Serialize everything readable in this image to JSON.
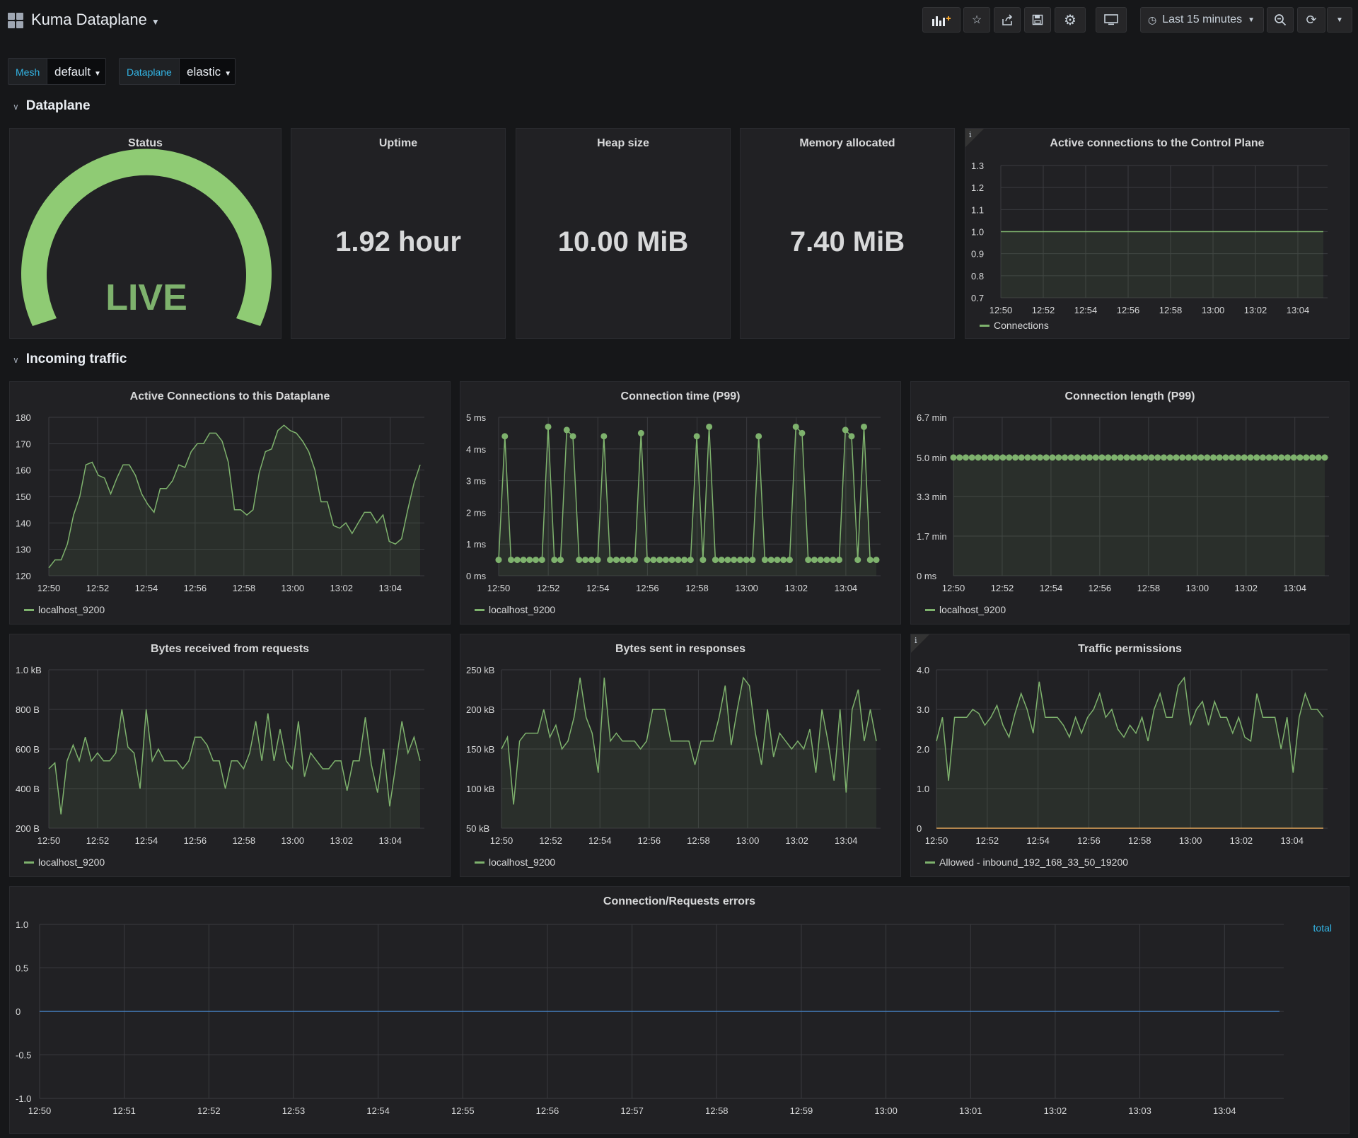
{
  "header": {
    "title": "Kuma Dataplane",
    "time_range": "Last 15 minutes"
  },
  "variables": [
    {
      "label": "Mesh",
      "value": "default"
    },
    {
      "label": "Dataplane",
      "value": "elastic"
    }
  ],
  "rows": {
    "dataplane": "Dataplane",
    "incoming": "Incoming traffic"
  },
  "panels": {
    "status": {
      "title": "Status",
      "value": "LIVE"
    },
    "uptime": {
      "title": "Uptime",
      "value": "1.92 hour"
    },
    "heap": {
      "title": "Heap size",
      "value": "10.00 MiB"
    },
    "memory": {
      "title": "Memory allocated",
      "value": "7.40 MiB"
    }
  },
  "colors": {
    "green": "#7eb26d",
    "gauge": "#8fcb74",
    "blue": "#33b5e5",
    "orange": "#e5a85d",
    "errors": "#447ebc"
  },
  "icons": [
    "add-panel-icon",
    "star-icon",
    "share-icon",
    "save-icon",
    "gear-icon",
    "tv-icon",
    "clock-icon",
    "zoom-out-icon",
    "refresh-icon",
    "chevron-down-icon"
  ],
  "chart_data": [
    {
      "id": "ctrl",
      "type": "line",
      "title": "Active connections to the Control Plane",
      "x": [
        "12:50",
        "12:52",
        "12:54",
        "12:56",
        "12:58",
        "13:00",
        "13:02",
        "13:04"
      ],
      "ylim": [
        0.7,
        1.3
      ],
      "yticks": [
        "0.7",
        "0.8",
        "0.9",
        "1.0",
        "1.1",
        "1.2",
        "1.3"
      ],
      "series": [
        {
          "name": "Connections",
          "values": [
            1.0,
            1.0,
            1.0,
            1.0,
            1.0,
            1.0,
            1.0,
            1.0,
            1.0,
            1.0,
            1.0,
            1.0,
            1.0,
            1.0,
            1.0,
            1.0
          ]
        }
      ]
    },
    {
      "id": "conns",
      "type": "line",
      "title": "Active Connections to this Dataplane",
      "x": [
        "12:50",
        "12:52",
        "12:54",
        "12:56",
        "12:58",
        "13:00",
        "13:02",
        "13:04"
      ],
      "ylim": [
        120,
        180
      ],
      "yticks": [
        "120",
        "130",
        "140",
        "150",
        "160",
        "170",
        "180"
      ],
      "series": [
        {
          "name": "localhost_9200",
          "values": [
            123,
            126,
            126,
            132,
            143,
            150,
            162,
            163,
            158,
            157,
            151,
            157,
            162,
            162,
            158,
            151,
            147,
            144,
            153,
            153,
            156,
            162,
            161,
            167,
            170,
            170,
            174,
            174,
            171,
            163,
            145,
            145,
            143,
            145,
            159,
            167,
            168,
            175,
            177,
            175,
            174,
            171,
            167,
            160,
            148,
            148,
            139,
            138,
            140,
            136,
            140,
            144,
            144,
            140,
            143,
            133,
            132,
            134,
            145,
            155,
            162
          ]
        }
      ]
    },
    {
      "id": "conntime",
      "type": "line",
      "title": "Connection time (P99)",
      "x": [
        "12:50",
        "12:52",
        "12:54",
        "12:56",
        "12:58",
        "13:00",
        "13:02",
        "13:04"
      ],
      "ylim": [
        0,
        5
      ],
      "yticks": [
        "0 ms",
        "1 ms",
        "2 ms",
        "3 ms",
        "4 ms",
        "5 ms"
      ],
      "series": [
        {
          "name": "localhost_9200",
          "values": [
            0.5,
            4.4,
            0.5,
            0.5,
            0.5,
            0.5,
            0.5,
            0.5,
            4.7,
            0.5,
            0.5,
            4.6,
            4.4,
            0.5,
            0.5,
            0.5,
            0.5,
            4.4,
            0.5,
            0.5,
            0.5,
            0.5,
            0.5,
            4.5,
            0.5,
            0.5,
            0.5,
            0.5,
            0.5,
            0.5,
            0.5,
            0.5,
            4.4,
            0.5,
            4.7,
            0.5,
            0.5,
            0.5,
            0.5,
            0.5,
            0.5,
            0.5,
            4.4,
            0.5,
            0.5,
            0.5,
            0.5,
            0.5,
            4.7,
            4.5,
            0.5,
            0.5,
            0.5,
            0.5,
            0.5,
            0.5,
            4.6,
            4.4,
            0.5,
            4.7,
            0.5,
            0.5
          ]
        }
      ]
    },
    {
      "id": "connlen",
      "type": "line",
      "title": "Connection length (P99)",
      "x": [
        "12:50",
        "12:52",
        "12:54",
        "12:56",
        "12:58",
        "13:00",
        "13:02",
        "13:04"
      ],
      "ylim": [
        0,
        6.7
      ],
      "yticks": [
        "0 ms",
        "1.7 min",
        "3.3 min",
        "5.0 min",
        "6.7 min"
      ],
      "ytick_values": [
        0,
        1.675,
        3.35,
        5.0,
        6.7
      ],
      "series": [
        {
          "name": "localhost_9200",
          "values": [
            5.0,
            5.0,
            5.0,
            5.0,
            5.0,
            5.0,
            5.0,
            5.0,
            5.0,
            5.0,
            5.0,
            5.0,
            5.0,
            5.0,
            5.0,
            5.0,
            5.0,
            5.0,
            5.0,
            5.0,
            5.0,
            5.0,
            5.0,
            5.0,
            5.0,
            5.0,
            5.0,
            5.0,
            5.0,
            5.0,
            5.0,
            5.0,
            5.0,
            5.0,
            5.0,
            5.0,
            5.0,
            5.0,
            5.0,
            5.0,
            5.0,
            5.0,
            5.0,
            5.0,
            5.0,
            5.0,
            5.0,
            5.0,
            5.0,
            5.0,
            5.0,
            5.0,
            5.0,
            5.0,
            5.0,
            5.0,
            5.0,
            5.0,
            5.0,
            5.0,
            5.0
          ]
        }
      ]
    },
    {
      "id": "bytesrx",
      "type": "line",
      "title": "Bytes received from requests",
      "x": [
        "12:50",
        "12:52",
        "12:54",
        "12:56",
        "12:58",
        "13:00",
        "13:02",
        "13:04"
      ],
      "ylim": [
        200,
        1000
      ],
      "yticks": [
        "200 B",
        "400 B",
        "600 B",
        "800 B",
        "1.0 kB"
      ],
      "series": [
        {
          "name": "localhost_9200",
          "values": [
            500,
            530,
            270,
            540,
            620,
            540,
            660,
            540,
            580,
            540,
            540,
            580,
            800,
            610,
            580,
            400,
            800,
            540,
            600,
            540,
            540,
            540,
            500,
            540,
            660,
            660,
            620,
            540,
            540,
            400,
            540,
            540,
            500,
            580,
            740,
            540,
            780,
            540,
            700,
            540,
            500,
            740,
            460,
            580,
            540,
            500,
            500,
            540,
            540,
            390,
            540,
            540,
            760,
            520,
            380,
            600,
            310,
            520,
            740,
            580,
            660,
            540
          ]
        }
      ]
    },
    {
      "id": "bytestx",
      "type": "line",
      "title": "Bytes sent in responses",
      "x": [
        "12:50",
        "12:52",
        "12:54",
        "12:56",
        "12:58",
        "13:00",
        "13:02",
        "13:04"
      ],
      "ylim": [
        50,
        250
      ],
      "yticks": [
        "50 kB",
        "100 kB",
        "150 kB",
        "200 kB",
        "250 kB"
      ],
      "series": [
        {
          "name": "localhost_9200",
          "values": [
            150,
            165,
            80,
            160,
            170,
            170,
            170,
            200,
            165,
            180,
            150,
            160,
            190,
            240,
            190,
            170,
            120,
            240,
            160,
            170,
            160,
            160,
            160,
            150,
            160,
            200,
            200,
            200,
            160,
            160,
            160,
            160,
            130,
            160,
            160,
            160,
            190,
            230,
            155,
            200,
            240,
            230,
            170,
            130,
            200,
            140,
            170,
            160,
            150,
            160,
            150,
            175,
            120,
            200,
            160,
            110,
            200,
            95,
            200,
            225,
            160,
            200,
            160
          ]
        }
      ]
    },
    {
      "id": "perms",
      "type": "line",
      "title": "Traffic permissions",
      "x": [
        "12:50",
        "12:52",
        "12:54",
        "12:56",
        "12:58",
        "13:00",
        "13:02",
        "13:04"
      ],
      "ylim": [
        0,
        4
      ],
      "yticks": [
        "0",
        "1.0",
        "2.0",
        "3.0",
        "4.0"
      ],
      "series": [
        {
          "name": "Allowed - inbound_192_168_33_50_19200",
          "values": [
            2.2,
            2.8,
            1.2,
            2.8,
            2.8,
            2.8,
            3.0,
            2.9,
            2.6,
            2.8,
            3.1,
            2.6,
            2.3,
            2.9,
            3.4,
            3.0,
            2.4,
            3.7,
            2.8,
            2.8,
            2.8,
            2.6,
            2.3,
            2.8,
            2.4,
            2.8,
            3.0,
            3.4,
            2.8,
            3.0,
            2.5,
            2.3,
            2.6,
            2.4,
            2.8,
            2.2,
            3.0,
            3.4,
            2.8,
            2.8,
            3.6,
            3.8,
            2.6,
            3.0,
            3.2,
            2.6,
            3.2,
            2.8,
            2.8,
            2.4,
            2.8,
            2.3,
            2.2,
            3.4,
            2.8,
            2.8,
            2.8,
            2.0,
            2.8,
            1.4,
            2.8,
            3.4,
            3.0,
            3.0,
            2.8
          ]
        },
        {
          "name": "",
          "values": [
            0,
            0,
            0,
            0,
            0,
            0,
            0,
            0,
            0,
            0,
            0,
            0,
            0,
            0,
            0,
            0,
            0,
            0,
            0,
            0,
            0,
            0,
            0,
            0,
            0,
            0,
            0,
            0,
            0,
            0,
            0,
            0,
            0,
            0,
            0,
            0,
            0,
            0,
            0,
            0,
            0,
            0,
            0,
            0,
            0,
            0,
            0,
            0,
            0,
            0,
            0,
            0,
            0,
            0,
            0,
            0,
            0,
            0,
            0,
            0,
            0,
            0,
            0,
            0,
            0
          ]
        }
      ]
    },
    {
      "id": "errors",
      "type": "line",
      "title": "Connection/Requests errors",
      "x": [
        "12:50",
        "12:51",
        "12:52",
        "12:53",
        "12:54",
        "12:55",
        "12:56",
        "12:57",
        "12:58",
        "12:59",
        "13:00",
        "13:01",
        "13:02",
        "13:03",
        "13:04"
      ],
      "ylim": [
        -1.0,
        1.0
      ],
      "yticks": [
        "-1.0",
        "-0.5",
        "0",
        "0.5",
        "1.0"
      ],
      "series": [
        {
          "name": "total",
          "values": [
            0,
            0,
            0,
            0,
            0,
            0,
            0,
            0,
            0,
            0,
            0,
            0,
            0,
            0,
            0
          ]
        }
      ]
    }
  ]
}
